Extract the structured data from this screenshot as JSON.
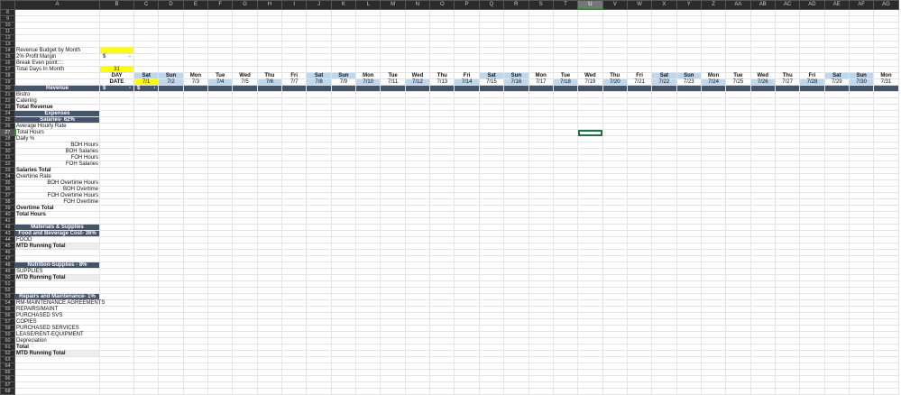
{
  "columns": [
    "A",
    "B",
    "C",
    "D",
    "E",
    "F",
    "G",
    "H",
    "I",
    "J",
    "K",
    "L",
    "M",
    "N",
    "O",
    "P",
    "Q",
    "R",
    "S",
    "T",
    "U",
    "V",
    "W",
    "X",
    "Y",
    "Z",
    "AA",
    "AB",
    "AC",
    "AD",
    "AE",
    "AF",
    "AG"
  ],
  "selected_column": "U",
  "selected_row": 27,
  "days": [
    "Sat",
    "Sun",
    "Mon",
    "Tue",
    "Wed",
    "Thu",
    "Fri",
    "Sat",
    "Sun",
    "Mon",
    "Tue",
    "Wed",
    "Thu",
    "Fri",
    "Sat",
    "Sun",
    "Mon",
    "Tue",
    "Wed",
    "Thu",
    "Fri",
    "Sat",
    "Sun",
    "Mon",
    "Tue",
    "Wed",
    "Thu",
    "Fri",
    "Sat",
    "Sun",
    "Mon"
  ],
  "dates": [
    "7/1",
    "7/2",
    "7/3",
    "7/4",
    "7/5",
    "7/6",
    "7/7",
    "7/8",
    "7/9",
    "7/10",
    "7/11",
    "7/12",
    "7/13",
    "7/14",
    "7/15",
    "7/16",
    "7/17",
    "7/18",
    "7/19",
    "7/20",
    "7/21",
    "7/22",
    "7/23",
    "7/24",
    "7/25",
    "7/26",
    "7/27",
    "7/28",
    "7/29",
    "7/30",
    "7/31"
  ],
  "labels": {
    "day": "DAY",
    "date": "DATE",
    "currency": "$",
    "dash": "-",
    "total_days": "31"
  },
  "colors": {
    "header_dark": "#44546a",
    "highlight": "#ffff00",
    "alt_blue": "#bdd7ee"
  },
  "rows": [
    {
      "n": 8,
      "a": ""
    },
    {
      "n": 9,
      "a": ""
    },
    {
      "n": 10,
      "a": ""
    },
    {
      "n": 11,
      "a": ""
    },
    {
      "n": 12,
      "a": ""
    },
    {
      "n": 13,
      "a": ""
    },
    {
      "n": 14,
      "a": "Revenue Budget by Month"
    },
    {
      "n": 15,
      "a": "2% Profit Margin"
    },
    {
      "n": 16,
      "a": "Break Even point::::"
    },
    {
      "n": 17,
      "a": "Total Days In Month"
    },
    {
      "n": 18,
      "a": ""
    },
    {
      "n": 19,
      "a": ""
    },
    {
      "n": 20,
      "a": "Revenue",
      "style": "dark"
    },
    {
      "n": 21,
      "a": "Bistro"
    },
    {
      "n": 22,
      "a": "Catering"
    },
    {
      "n": 23,
      "a": "Total Revenue",
      "style": "bold"
    },
    {
      "n": 24,
      "a": "Expenses",
      "style": "dark"
    },
    {
      "n": 25,
      "a": "Salaries- 62%",
      "style": "dark"
    },
    {
      "n": 26,
      "a": "Average Hourly Rate"
    },
    {
      "n": 27,
      "a": "Total Hours"
    },
    {
      "n": 28,
      "a": "Daily %"
    },
    {
      "n": 29,
      "a": "BOH Hours",
      "style": "right"
    },
    {
      "n": 30,
      "a": "BOH Salaries",
      "style": "right"
    },
    {
      "n": 31,
      "a": "FOH Hours",
      "style": "right"
    },
    {
      "n": 32,
      "a": "FOH Salaries",
      "style": "right"
    },
    {
      "n": 33,
      "a": "Salaries Total",
      "style": "bold"
    },
    {
      "n": 34,
      "a": "Overtime Rate"
    },
    {
      "n": 35,
      "a": "BOH Overtime Hours",
      "style": "right"
    },
    {
      "n": 36,
      "a": "BOH Overtime",
      "style": "right"
    },
    {
      "n": 37,
      "a": "FOH Overtime Hours",
      "style": "right"
    },
    {
      "n": 38,
      "a": "FOH Overtime",
      "style": "right"
    },
    {
      "n": 39,
      "a": "Overtime Total",
      "style": "bold"
    },
    {
      "n": 40,
      "a": "Total Hours",
      "style": "bold"
    },
    {
      "n": 41,
      "a": ""
    },
    {
      "n": 42,
      "a": "Materials & Supplies",
      "style": "dark"
    },
    {
      "n": 43,
      "a": "Food and Beverage Cost- 36%",
      "style": "dark"
    },
    {
      "n": 44,
      "a": "FOOD"
    },
    {
      "n": 45,
      "a": "MTD Running Total",
      "style": "bold grey"
    },
    {
      "n": 46,
      "a": ""
    },
    {
      "n": 47,
      "a": ""
    },
    {
      "n": 48,
      "a": "Nutrition-Supplies - 8%",
      "style": "dark"
    },
    {
      "n": 49,
      "a": "SUPPLIES"
    },
    {
      "n": 50,
      "a": "MTD Running Total",
      "style": "bold grey"
    },
    {
      "n": 51,
      "a": ""
    },
    {
      "n": 52,
      "a": ""
    },
    {
      "n": 53,
      "a": "Repairs and Maintenance- 1%",
      "style": "dark"
    },
    {
      "n": 54,
      "a": "RM-MAINTENANCE AGREEMENTS"
    },
    {
      "n": 55,
      "a": "REPAIRS/MAINT"
    },
    {
      "n": 56,
      "a": "PURCHASED SVS"
    },
    {
      "n": 57,
      "a": "COPIES"
    },
    {
      "n": 58,
      "a": "PURCHASED SERVICES"
    },
    {
      "n": 59,
      "a": "LEASE/RENT-EQUIPMENT"
    },
    {
      "n": 60,
      "a": "Depreciation"
    },
    {
      "n": 61,
      "a": "Total",
      "style": "bold"
    },
    {
      "n": 62,
      "a": "MTD Running Total",
      "style": "bold grey"
    },
    {
      "n": 63,
      "a": ""
    },
    {
      "n": 64,
      "a": ""
    },
    {
      "n": 65,
      "a": ""
    },
    {
      "n": 66,
      "a": ""
    },
    {
      "n": 67,
      "a": ""
    },
    {
      "n": 68,
      "a": ""
    }
  ]
}
